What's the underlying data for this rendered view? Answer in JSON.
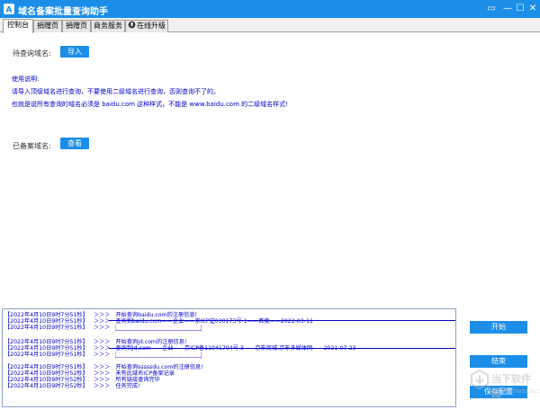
{
  "window": {
    "title": "域名备案批量查询助手",
    "controls": {
      "menu": "▭",
      "minimize": "—",
      "maximize": "☐",
      "close": "✕"
    }
  },
  "tabs": [
    {
      "label": "控制台",
      "active": true
    },
    {
      "label": "捐赠页"
    },
    {
      "label": "捐赠页"
    },
    {
      "label": "商务服务"
    },
    {
      "label": "在线升级",
      "icon": "globe-icon"
    }
  ],
  "main": {
    "pending_label": "待查询域名:",
    "import_button": "导入",
    "usage_title": "使用说明:",
    "usage_line1": "请导入顶级域名进行查询，不要使用二级域名进行查询，否则查询不了的。",
    "usage_line2": "也就是说所有查询的域名必须是  baidu.com 这种样式，不能是 www.baidu.com 的二级域名样式!",
    "recorded_label": "已备案域名:",
    "view_button": "查看"
  },
  "log": {
    "lines": [
      {
        "ts": "【2022年4月10日9时7分51秒】",
        "arrow": "＞＞＞",
        "msg": "开始查询baidu.com的注册信息!",
        "style": "text"
      },
      {
        "ts": "【2022年4月10日9时7分51秒】",
        "arrow": "＞＞＞",
        "msg": "查询到baidu.com——企业——京ICP证030173号-1——百度——2022-03-11",
        "style": "text"
      },
      {
        "ts": "【2022年4月10日9时7分51秒】",
        "arrow": "＞＞＞",
        "msg": "████████████████████",
        "style": "bar"
      },
      {
        "ts": "【2022年4月10日9时7分51秒】",
        "arrow": "＞＞＞",
        "msg": "开始查询jd.com的注册信息!",
        "style": "text"
      },
      {
        "ts": "【2022年4月10日9时7分51秒】",
        "arrow": "＞＞＞",
        "msg": "查询到jd.com——企业——京ICP备11041704号-3——京东商城,京东多媒体网——2021-07-23",
        "style": "text"
      },
      {
        "ts": "【2022年4月10日9时7分51秒】",
        "arrow": "＞＞＞",
        "msg": "████████████████████",
        "style": "bar"
      },
      {
        "ts": "【2022年4月10日9时7分51秒】",
        "arrow": "＞＞＞",
        "msg": "开始查询sssssdu.com的注册信息!",
        "style": "text"
      },
      {
        "ts": "【2022年4月10日9时7分52秒】",
        "arrow": "＞＞＞",
        "msg": "未有此域名ICP备案记录",
        "style": "text"
      },
      {
        "ts": "【2022年4月10日9时7分52秒】",
        "arrow": "＞＞＞",
        "msg": "所有链接查询完毕",
        "style": "text"
      },
      {
        "ts": "【2022年4月10日9时7分52秒】",
        "arrow": "＞＞＞",
        "msg": "任务完成!",
        "style": "text"
      }
    ]
  },
  "side": {
    "start_button": "开始",
    "end_button": "结束",
    "save_button": "保存配置"
  },
  "watermark": {
    "text": "当下软件园",
    "url": "www.downxia.com"
  },
  "colors": {
    "accent": "#1c8ee8",
    "log_text": "#0000cc"
  }
}
